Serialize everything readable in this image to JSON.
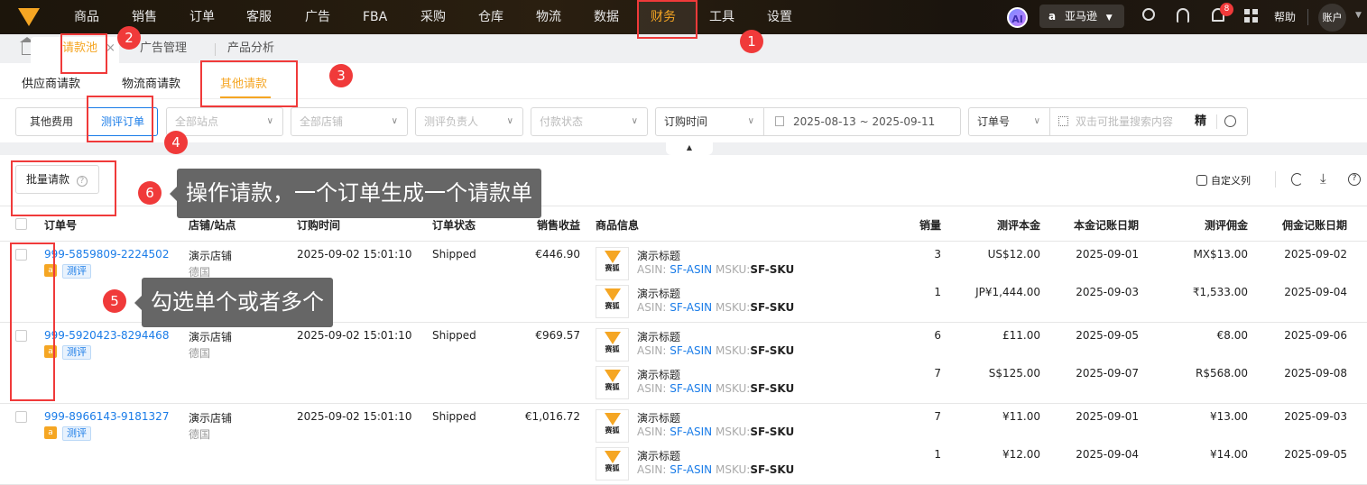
{
  "topnav": {
    "items": [
      "商品",
      "销售",
      "订单",
      "客服",
      "广告",
      "FBA",
      "采购",
      "仓库",
      "物流",
      "数据",
      "财务",
      "工具",
      "设置"
    ],
    "active": "财务",
    "ai_label": "AI",
    "marketplace": "亚马逊",
    "notification_count": "8",
    "help": "帮助",
    "account": "账户"
  },
  "tabs": [
    "请款池",
    "广告管理",
    "产品分析"
  ],
  "subtabs": [
    "供应商请款",
    "物流商请款",
    "其他请款"
  ],
  "filters": {
    "segments": [
      "其他费用",
      "测评订单"
    ],
    "site": "全部站点",
    "store": "全部店铺",
    "owner": "测评负责人",
    "payment": "付款状态",
    "date_type": "订购时间",
    "date_start": "2025-08-13",
    "date_sep": "~",
    "date_end": "2025-09-11",
    "search_field": "订单号",
    "search_placeholder": "双击可批量搜索内容",
    "exact": "精"
  },
  "toolbar": {
    "batch_request": "批量请款",
    "custom_columns": "自定义列"
  },
  "columns": [
    "订单号",
    "店铺/站点",
    "订购时间",
    "订单状态",
    "销售收益",
    "商品信息",
    "销量",
    "测评本金",
    "本金记账日期",
    "测评佣金",
    "佣金记账日期"
  ],
  "rows": [
    {
      "order_no": "999-5859809-2224502",
      "tag": "测评",
      "store": "演示店铺",
      "site": "德国",
      "time": "2025-09-02 15:01:10",
      "status": "Shipped",
      "revenue": "€446.90",
      "products": [
        {
          "title": "演示标题",
          "asin": "SF-ASIN",
          "msku": "SF-SKU",
          "qty": "3",
          "principal": "US$12.00",
          "principal_date": "2025-09-01",
          "commission": "MX$13.00",
          "commission_date": "2025-09-02"
        },
        {
          "title": "演示标题",
          "asin": "SF-ASIN",
          "msku": "SF-SKU",
          "qty": "1",
          "principal": "JP¥1,444.00",
          "principal_date": "2025-09-03",
          "commission": "₹1,533.00",
          "commission_date": "2025-09-04"
        }
      ]
    },
    {
      "order_no": "999-5920423-8294468",
      "tag": "测评",
      "store": "演示店铺",
      "site": "德国",
      "time": "2025-09-02 15:01:10",
      "status": "Shipped",
      "revenue": "€969.57",
      "products": [
        {
          "title": "演示标题",
          "asin": "SF-ASIN",
          "msku": "SF-SKU",
          "qty": "6",
          "principal": "£11.00",
          "principal_date": "2025-09-05",
          "commission": "€8.00",
          "commission_date": "2025-09-06"
        },
        {
          "title": "演示标题",
          "asin": "SF-ASIN",
          "msku": "SF-SKU",
          "qty": "7",
          "principal": "S$125.00",
          "principal_date": "2025-09-07",
          "commission": "R$568.00",
          "commission_date": "2025-09-08"
        }
      ]
    },
    {
      "order_no": "999-8966143-9181327",
      "tag": "测评",
      "store": "演示店铺",
      "site": "德国",
      "time": "2025-09-02 15:01:10",
      "status": "Shipped",
      "revenue": "€1,016.72",
      "products": [
        {
          "title": "演示标题",
          "asin": "SF-ASIN",
          "msku": "SF-SKU",
          "qty": "7",
          "principal": "¥11.00",
          "principal_date": "2025-09-01",
          "commission": "¥13.00",
          "commission_date": "2025-09-03"
        },
        {
          "title": "演示标题",
          "asin": "SF-ASIN",
          "msku": "SF-SKU",
          "qty": "1",
          "principal": "¥12.00",
          "principal_date": "2025-09-04",
          "commission": "¥14.00",
          "commission_date": "2025-09-05"
        }
      ]
    }
  ],
  "labels": {
    "asin": "ASIN: ",
    "msku": "MSKU:",
    "thumb": "赛狐"
  },
  "annotations": {
    "numbers": [
      "1",
      "2",
      "3",
      "4",
      "5",
      "6"
    ],
    "tip5": "勾选单个或者多个",
    "tip6": "操作请款，一个订单生成一个请款单"
  },
  "colors": {
    "accent": "#f5a623",
    "link": "#1a7ce8",
    "annotation": "#f03a3a"
  }
}
